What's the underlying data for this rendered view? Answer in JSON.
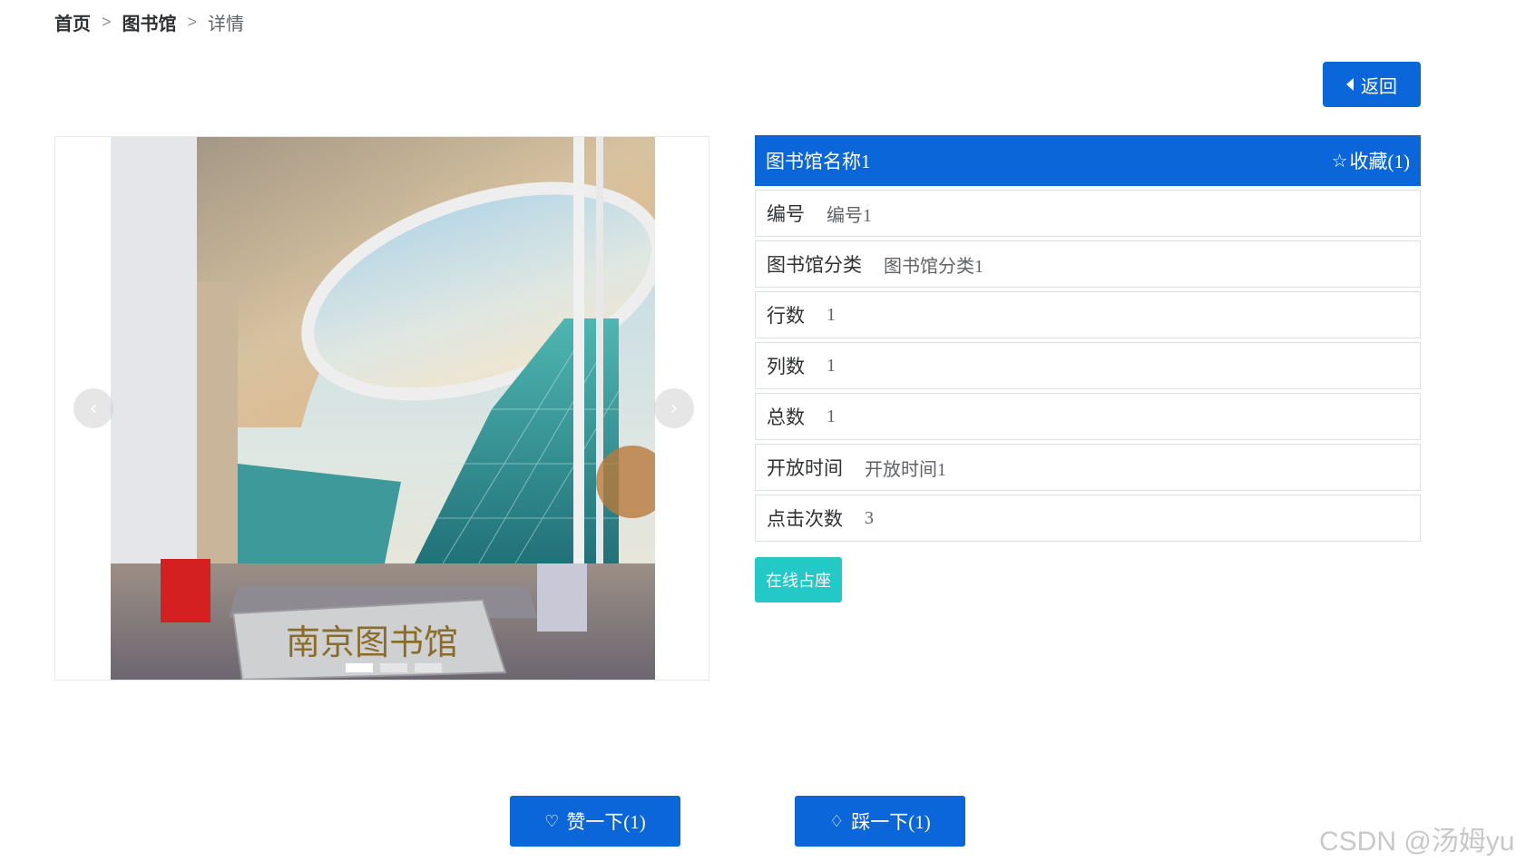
{
  "breadcrumb": {
    "home": "首页",
    "separator": ">",
    "section": "图书馆",
    "current": "详情"
  },
  "back_button": {
    "label": "返回",
    "icon": "caret-left-icon"
  },
  "carousel": {
    "prev_symbol": "‹",
    "next_symbol": "›",
    "slide_count": 3,
    "active_index": 0,
    "image_sign_text": "南京图书馆"
  },
  "detail": {
    "title": "图书馆名称1",
    "favorite_label": "收藏(1)",
    "favorite_icon": "star-outline-icon",
    "rows": [
      {
        "label": "编号",
        "value": "编号1"
      },
      {
        "label": "图书馆分类",
        "value": "图书馆分类1"
      },
      {
        "label": "行数",
        "value": "1"
      },
      {
        "label": "列数",
        "value": "1"
      },
      {
        "label": "总数",
        "value": "1"
      },
      {
        "label": "开放时间",
        "value": "开放时间1"
      },
      {
        "label": "点击次数",
        "value": "3"
      }
    ]
  },
  "seat_button": {
    "label": "在线占座"
  },
  "actions": {
    "like_label": "赞一下(1)",
    "dislike_label": "踩一下(1)"
  },
  "watermark": "CSDN @汤姆yu",
  "colors": {
    "primary": "#0a66d9",
    "seat_button": "#22c9c7",
    "border": "#dcdfe6"
  }
}
